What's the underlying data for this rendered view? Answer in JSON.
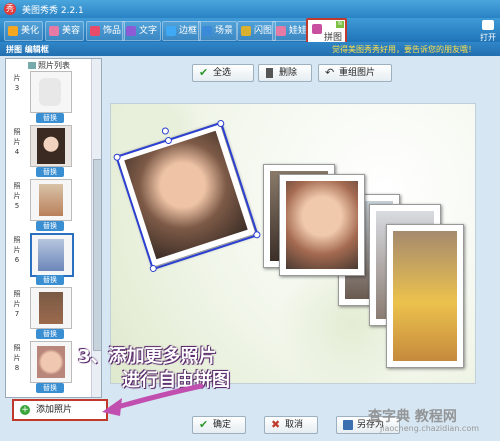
{
  "window": {
    "title": "美图秀秀 2.2.1"
  },
  "toolbar": {
    "tabs": [
      {
        "label": "美化",
        "color": "#f5a623"
      },
      {
        "label": "美容",
        "color": "#e57aa5"
      },
      {
        "label": "饰品",
        "color": "#e94b6a"
      },
      {
        "label": "文字",
        "color": "#8e5bd6"
      },
      {
        "label": "边框",
        "color": "#3fa9f5"
      },
      {
        "label": "场景",
        "color": "#3c8bd8"
      },
      {
        "label": "闪图",
        "color": "#d9b02f"
      },
      {
        "label": "娃娃",
        "color": "#e57aa5"
      },
      {
        "label": "拼图",
        "color": "#c94fa0"
      }
    ],
    "new_badge": "N",
    "open_label": "打开"
  },
  "subbar": {
    "label": "拼图 编辑框",
    "notice": "觉得美图秀秀好用，要告诉您的朋友哦！"
  },
  "photo_list": {
    "header": "照片列表",
    "items": [
      {
        "index": "片3",
        "replace_label": "替换",
        "tone": "#e8e8e8"
      },
      {
        "index": "照片4",
        "replace_label": "替换",
        "tone": "#3a2a22"
      },
      {
        "index": "照片5",
        "replace_label": "替换",
        "tone": "#b9805a"
      },
      {
        "index": "照片6",
        "replace_label": "替换",
        "tone": "#6b86b8"
      },
      {
        "index": "照片7",
        "replace_label": "替换",
        "tone": "#9b6a4d"
      },
      {
        "index": "照片8",
        "replace_label": "替换",
        "tone": "#d9a58a"
      }
    ],
    "add_label": "添加照片"
  },
  "actions": {
    "select_all": "全选",
    "delete": "删除",
    "rearrange": "重组图片"
  },
  "footer": {
    "confirm": "确定",
    "cancel": "取消",
    "save_as": "另存为"
  },
  "annotation": {
    "line1": "3、添加更多照片",
    "line2": "进行自由拼图"
  },
  "watermark": {
    "main": "查字典 教程网",
    "sub": "jiaocheng.chazidian.com"
  },
  "colors": {
    "accent": "#2a82c4",
    "highlight": "#c0392b",
    "selection": "#2b3fd1"
  }
}
